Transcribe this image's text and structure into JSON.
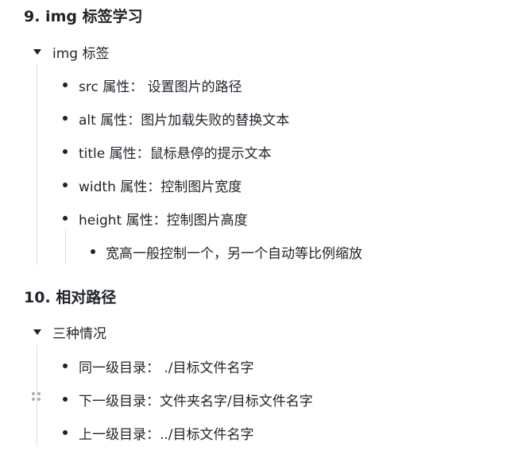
{
  "section1": {
    "heading": "9. img 标签学习",
    "toggle_label": "img 标签",
    "items": [
      "src 属性：  设置图片的路径",
      "alt 属性：图片加载失败的替换文本",
      "title 属性：鼠标悬停的提示文本",
      "width 属性：控制图片宽度",
      "height 属性：控制图片高度"
    ],
    "subitems": [
      "宽高一般控制一个，另一个自动等比例缩放"
    ]
  },
  "section2": {
    "heading": "10. 相对路径",
    "toggle_label": "三种情况",
    "items": [
      "同一级目录：  ./目标文件名字",
      "下一级目录：文件夹名字/目标文件名字",
      "上一级目录：../目标文件名字"
    ]
  },
  "icons": {
    "toggle": "triangle-down-icon",
    "bullet": "bullet-dot-icon",
    "drag": "drag-handle-icon"
  }
}
